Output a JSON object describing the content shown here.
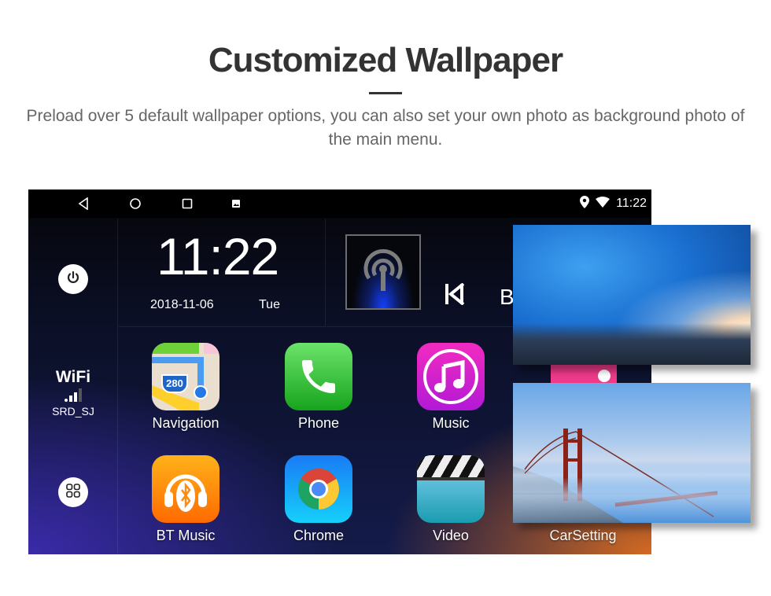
{
  "header": {
    "title": "Customized Wallpaper",
    "subtitle": "Preload over 5 default wallpaper options, you can also set your own photo as background photo of the main menu."
  },
  "statusbar": {
    "nav_icons": [
      "back-icon",
      "home-icon",
      "recents-icon",
      "screenshot-icon"
    ],
    "status_icons": [
      "location-icon",
      "wifi-icon"
    ],
    "time": "11:22"
  },
  "sidebar": {
    "power_icon": "power-icon",
    "wifi": {
      "title": "WiFi",
      "ssid": "SRD_SJ",
      "signal_bars_lit": 3,
      "signal_bars_total": 4
    },
    "apps_icon": "apps-grid-icon"
  },
  "clock": {
    "time": "11:22",
    "date": "2018-11-06",
    "day": "Tue"
  },
  "media": {
    "art_icon": "radio-antenna-icon",
    "prev_icon": "skip-previous-icon",
    "title_partial": "B"
  },
  "apps": [
    {
      "label": "Navigation",
      "icon": "maps-icon"
    },
    {
      "label": "Phone",
      "icon": "phone-icon"
    },
    {
      "label": "Music",
      "icon": "music-note-icon"
    },
    {
      "label": "BT Music",
      "icon": "bluetooth-headphones-icon"
    },
    {
      "label": "Chrome",
      "icon": "chrome-icon"
    },
    {
      "label": "Video",
      "icon": "clapperboard-icon"
    },
    {
      "label": "CarSetting",
      "icon": "car-setting-icon"
    }
  ],
  "map_badge": "280",
  "wallpapers": [
    {
      "name": "ice-cave"
    },
    {
      "name": "golden-gate-bridge"
    }
  ]
}
